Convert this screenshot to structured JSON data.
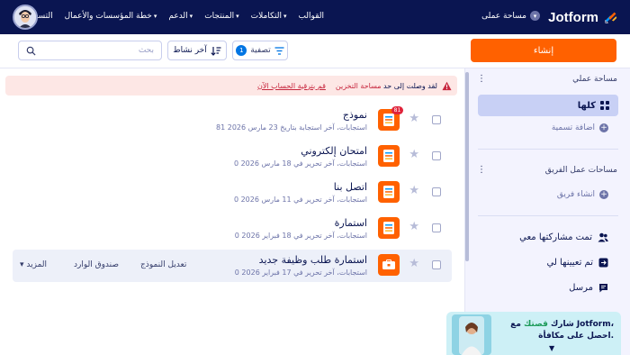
{
  "nav": {
    "brand": "Jotform",
    "workspace": "مساحة عملى",
    "menu": [
      "القوالب",
      "التكاملات",
      "المنتجات",
      "الدعم",
      "خطة المؤسسات والأعمال",
      "التسعير"
    ],
    "menu_dropdown": [
      true,
      true,
      true,
      true,
      false,
      false
    ]
  },
  "toolbar": {
    "create_label": "إنشاء",
    "search_placeholder": "بحث",
    "sort_label": "آخر نشاط",
    "filter_label": "تصفية",
    "filter_count": "1"
  },
  "alert": {
    "text_prefix": "لقد وصلت إلى حد",
    "text_bold": "مساحة التخزين",
    "link": "قم بترقية الحساب الآن"
  },
  "sidebar": {
    "my_workspace": "مساحة عملي",
    "all": "كلها",
    "add_label": "اضافة تسمية",
    "team_workspaces": "مساحات عمل الفريق",
    "create_team": "انشاء فريق",
    "shared_with_me": "تمت مشاركتها معي",
    "assigned_to_me": "تم تعيينها لي",
    "sent": "مرسل"
  },
  "forms": [
    {
      "title": "نموذج",
      "meta": "81 استجابات، آخر استجابة بتاريخ 23 مارس 2026",
      "badge": "81"
    },
    {
      "title": "امتحان إلكتروني",
      "meta": "0 استجابات، آخر تحرير في 18 مارس 2026"
    },
    {
      "title": "اتصل بنا",
      "meta": "0 استجابات، آخر تحرير في 11 مارس 2026"
    },
    {
      "title": "استمارة",
      "meta": "0 استجابات، آخر تحرير في 18 فبراير 2026"
    },
    {
      "title": "استمارة طلب وظيفة جديد",
      "meta": "0 استجابات، آخر تحرير في 17 فبراير 2026"
    }
  ],
  "row_actions": {
    "edit": "تعديل النموذج",
    "inbox": "صندوق الوارد",
    "more": "المزيد"
  },
  "promo": {
    "line1_a": "شارك",
    "line1_green": "قصتك",
    "line1_b": "مع Jotform،",
    "line2": "احصل على مكافأة."
  },
  "colors": {
    "navy": "#0a1551",
    "orange": "#ff6100",
    "blue": "#0075e3",
    "alert_bg": "#fde7e5",
    "alert_red": "#c7273e"
  }
}
